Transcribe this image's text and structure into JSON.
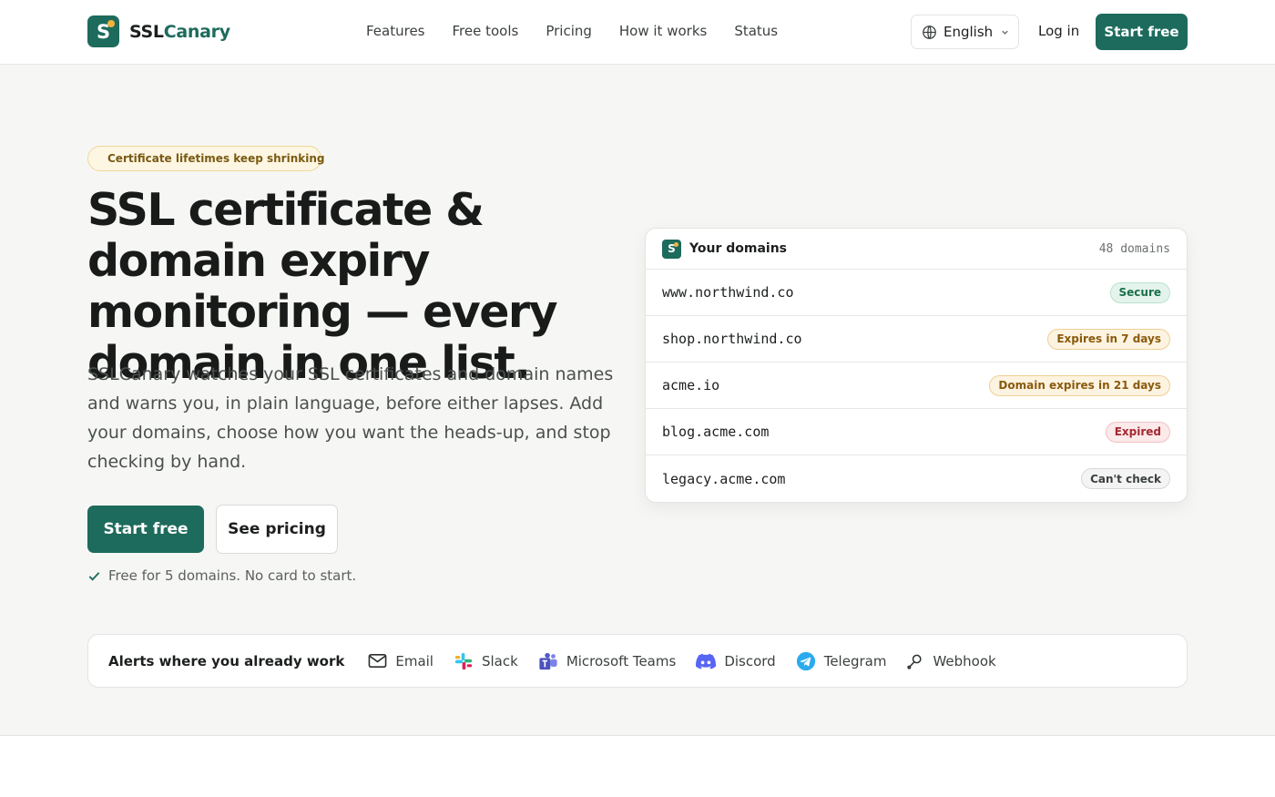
{
  "brand": {
    "name_part1": "SSL",
    "name_part2": "Canary",
    "mark_letter": "S",
    "accent": "#1d6b5c",
    "dot_color": "#f3b33d"
  },
  "nav": {
    "items": [
      "Features",
      "Free tools",
      "Pricing",
      "How it works",
      "Status"
    ]
  },
  "header": {
    "language": "English",
    "login_label": "Log in",
    "start_label": "Start free"
  },
  "hero": {
    "pill_label": "Certificate lifetimes keep shrinking",
    "headline": "SSL certificate & domain expiry monitoring — every domain in one list.",
    "subtext": "SSLCanary watches your SSL certificates and domain names and warns you, in plain language, before either lapses. Add your domains, choose how you want the heads-up, and stop checking by hand.",
    "primary_cta": "Start free",
    "secondary_cta": "See pricing",
    "note": "Free for 5 domains. No card to start."
  },
  "domains_card": {
    "title": "Your domains",
    "count": "48 domains",
    "rows": [
      {
        "domain": "www.northwind.co",
        "status": "Secure",
        "tone": "green"
      },
      {
        "domain": "shop.northwind.co",
        "status": "Expires in 7 days",
        "tone": "amber"
      },
      {
        "domain": "acme.io",
        "status": "Domain expires in 21 days",
        "tone": "amber"
      },
      {
        "domain": "blog.acme.com",
        "status": "Expired",
        "tone": "red"
      },
      {
        "domain": "legacy.acme.com",
        "status": "Can't check",
        "tone": "gray"
      }
    ]
  },
  "alerts": {
    "label": "Alerts where you already work",
    "channels": [
      {
        "name": "Email",
        "icon": "mail-icon"
      },
      {
        "name": "Slack",
        "icon": "slack-icon"
      },
      {
        "name": "Microsoft Teams",
        "icon": "teams-icon"
      },
      {
        "name": "Discord",
        "icon": "discord-icon"
      },
      {
        "name": "Telegram",
        "icon": "telegram-icon"
      },
      {
        "name": "Webhook",
        "icon": "webhook-icon"
      }
    ]
  }
}
